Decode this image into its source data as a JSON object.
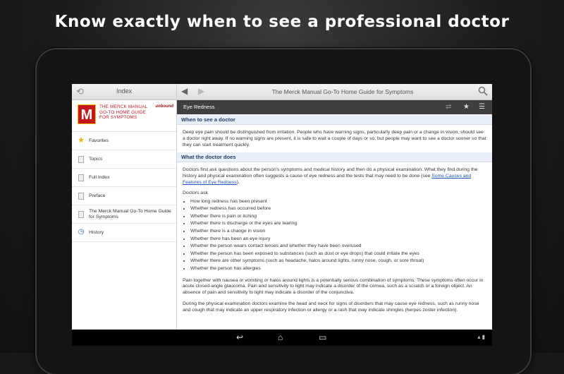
{
  "headline": "Know exactly when to see a professional doctor",
  "left_pane": {
    "title": "Index",
    "brand_text": "THE MERCK MANUAL GO-TO HOME GUIDE FOR SYMPTOMS",
    "publisher": "unbound",
    "items": [
      {
        "label": "Favorites",
        "icon": "star-icon"
      },
      {
        "label": "Topics",
        "icon": "page-icon"
      },
      {
        "label": "Full Index",
        "icon": "page-icon"
      },
      {
        "label": "Preface",
        "icon": "page-icon"
      },
      {
        "label": "The Merck Manual Go-To Home Guide for Symptoms",
        "icon": "page-icon"
      },
      {
        "label": "History",
        "icon": "clock-icon"
      }
    ]
  },
  "right_pane": {
    "title": "The Merck Manual Go-To Home Guide for Symptoms",
    "topic": "Eye Redness",
    "sections": {
      "when_heading": "When to see a doctor",
      "when_text": "Deep eye pain should be distinguished from irritation. People who have warning signs, particularly deep pain or a change in vision, should see a doctor right away. If no warning signs are present, it is safe to wait a couple of days or so, but people may want to see a doctor sooner so that they can start treatment quickly.",
      "what_heading": "What the doctor does",
      "what_text_1": "Doctors first ask questions about the person's symptoms and medical history and then do a physical examination. What they find during the history and physical examination often suggests a cause of eye redness and the tests that may need to be done (see ",
      "what_link": "Some Causes and Features of Eye Redness",
      "what_text_2": ").",
      "doctors_ask": "Doctors ask",
      "bullets": [
        "How long redness has been present",
        "Whether redness has occurred before",
        "Whether there is pain or itching",
        "Whether there is discharge or the eyes are tearing",
        "Whether there is a change in vision",
        "Whether there has been an eye injury",
        "Whether the person wears contact lenses and whether they have been overused",
        "Whether the person has been exposed to substances (such as dust or eye drops) that could irritate the eyes",
        "Whether there are other symptoms (such as headache, halos around lights, runny nose, cough, or sore throat)",
        "Whether the person has allergies"
      ],
      "para_pain": "Pain together with nausea or vomiting or halos around lights is a potentially serious combination of symptoms. These symptoms often occur in acute closed-angle glaucoma. Pain and sensitivity to light may indicate a disorder of the cornea, such as a scratch or a foreign object. An absence of pain and sensitivity to light may indicate a disorder of the conjunctiva.",
      "para_exam": "During the physical examination doctors examine the head and neck for signs of disorders that may cause eye redness, such as runny nose and cough that may indicate an upper respiratory infection or allergy or a rash that may indicate shingles (herpes zoster infection)."
    }
  }
}
